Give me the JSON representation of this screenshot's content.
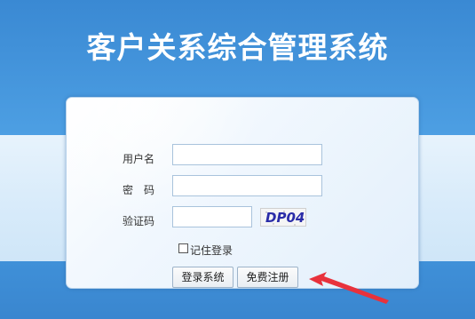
{
  "header": {
    "title": "客户关系综合管理系统"
  },
  "login_form": {
    "username_label": "用户名",
    "username_value": "",
    "password_label": "密　码",
    "password_value": "",
    "captcha_label": "验证码",
    "captcha_value": "",
    "captcha_image_text": "DP04",
    "remember_label": "记住登录",
    "remember_checked": false,
    "login_button": "登录系统",
    "register_button": "免费注册"
  },
  "annotation": {
    "arrow_color": "#e8323c",
    "arrow_icon": "red-arrow-icon"
  },
  "colors": {
    "background_blue": "#3f8fd6",
    "panel_light": "#eef6fd",
    "captcha_text": "#2a2ca8"
  }
}
